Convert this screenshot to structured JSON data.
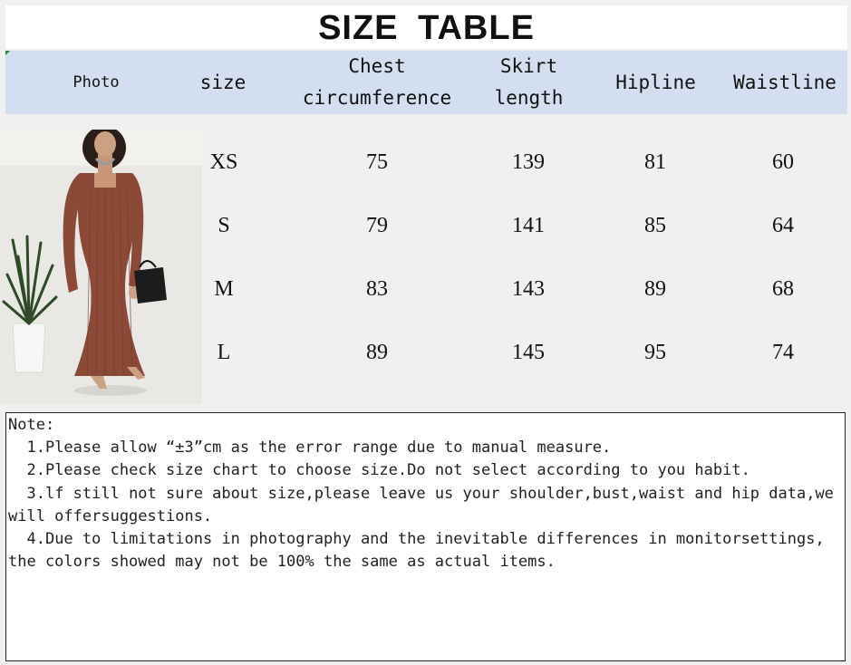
{
  "title": "SIZE TABLE",
  "table": {
    "headers": [
      "Photo",
      "size",
      "Chest\ncircumference",
      "Skirt\nlength",
      "Hipline",
      "Waistline"
    ],
    "rows": [
      {
        "size": "XS",
        "chest": "75",
        "skirt": "139",
        "hip": "81",
        "waist": "60"
      },
      {
        "size": "S",
        "chest": "79",
        "skirt": "141",
        "hip": "85",
        "waist": "64"
      },
      {
        "size": "M",
        "chest": "83",
        "skirt": "143",
        "hip": "89",
        "waist": "68"
      },
      {
        "size": "L",
        "chest": "89",
        "skirt": "145",
        "hip": "95",
        "waist": "74"
      }
    ]
  },
  "note": {
    "label": "Note:",
    "lines": [
      "  1.Please allow “±3”cm as the error range due to manual measure.",
      "  2.Please check size chart to choose size.Do not select according to you habit.",
      "  3.lf still not sure about size,please leave us your shoulder,bust,waist and hip data,we will offersuggestions.",
      "  4.Due to limitations in photography and the inevitable differences in monitorsettings, the colors showed may not be 100% the same as actual items."
    ]
  },
  "colors": {
    "header_bg": "#d3def0",
    "page_bg": "#f0f0f0",
    "dress": "#8b4a37"
  }
}
